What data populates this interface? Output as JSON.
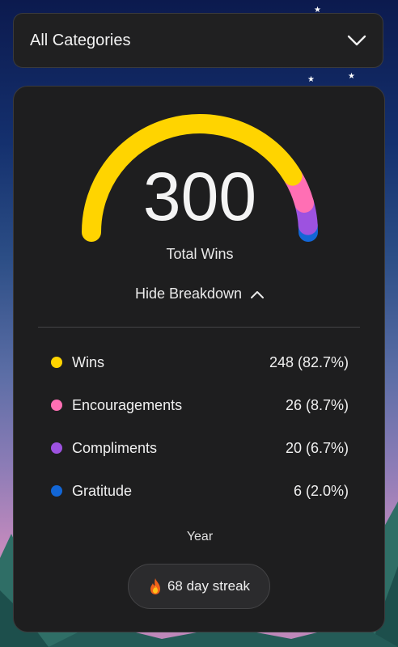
{
  "background": {
    "gradient_top": "#0c1a4e",
    "gradient_bottom": "#d793c0"
  },
  "category_select": {
    "selected": "All Categories",
    "icon": "chevron-down-icon"
  },
  "summary": {
    "total_value": "300",
    "total_label": "Total Wins",
    "toggle_label": "Hide Breakdown",
    "toggle_icon": "chevron-up-icon"
  },
  "chart_data": {
    "type": "gauge",
    "total": 300,
    "series": [
      {
        "name": "Wins",
        "value": 248,
        "percent": 82.7,
        "color": "#ffd400"
      },
      {
        "name": "Encouragements",
        "value": 26,
        "percent": 8.7,
        "color": "#ff6fb4"
      },
      {
        "name": "Compliments",
        "value": 20,
        "percent": 6.7,
        "color": "#9d52e0"
      },
      {
        "name": "Gratitude",
        "value": 6,
        "percent": 2.0,
        "color": "#1266d6"
      }
    ]
  },
  "breakdown": [
    {
      "label": "Wins",
      "value": "248 (82.7%)",
      "color": "#ffd400"
    },
    {
      "label": "Encouragements",
      "value": "26 (8.7%)",
      "color": "#ff6fb4"
    },
    {
      "label": "Compliments",
      "value": "20 (6.7%)",
      "color": "#9d52e0"
    },
    {
      "label": "Gratitude",
      "value": "6 (2.0%)",
      "color": "#1266d6"
    }
  ],
  "period": "Year",
  "streak": {
    "icon": "fire-icon",
    "label": "68 day streak"
  }
}
